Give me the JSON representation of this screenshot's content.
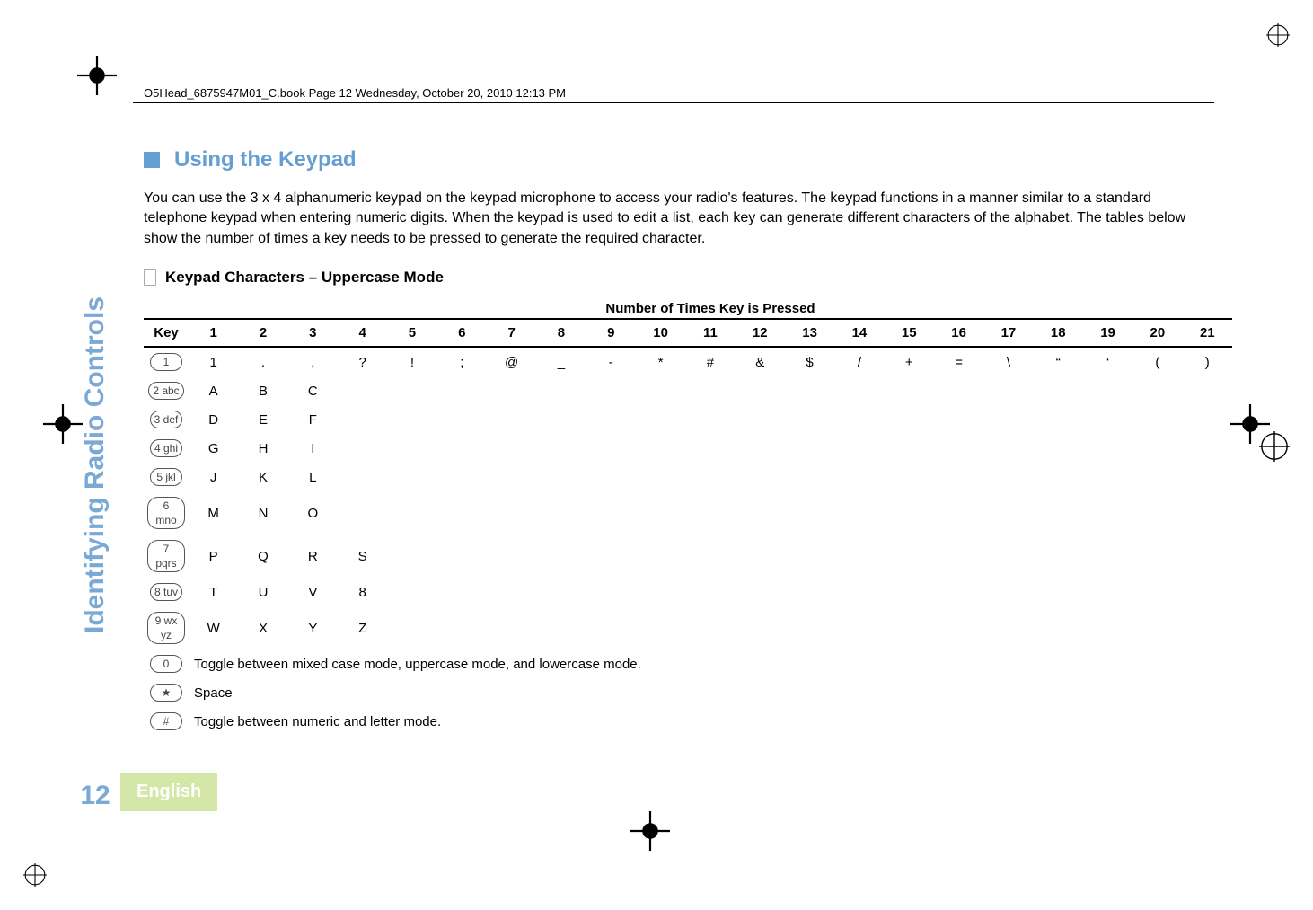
{
  "page_header": "O5Head_6875947M01_C.book  Page 12  Wednesday, October 20, 2010  12:13 PM",
  "sidebar": {
    "vertical_label": "Identifying Radio Controls",
    "page_number": "12",
    "language": "English"
  },
  "section": {
    "title": "Using the Keypad",
    "paragraph": "You can use the 3 x 4 alphanumeric keypad on the keypad microphone to access your radio's features. The keypad functions in a manner similar to a standard telephone keypad when entering numeric digits. When the keypad is used to edit a list, each key can generate different characters of the alphabet. The tables below show the number of times a key needs to be pressed to generate the required character.",
    "subheading": "Keypad Characters – Uppercase Mode"
  },
  "table": {
    "group_header": "Number of Times Key is Pressed",
    "key_label": "Key",
    "columns": {
      "c1": "1",
      "c2": "2",
      "c3": "3",
      "c4": "4",
      "c5": "5",
      "c6": "6",
      "c7": "7",
      "c8": "8",
      "c9": "9",
      "c10": "10",
      "c11": "11",
      "c12": "12",
      "c13": "13",
      "c14": "14",
      "c15": "15",
      "c16": "16",
      "c17": "17",
      "c18": "18",
      "c19": "19",
      "c20": "20",
      "c21": "21"
    },
    "rows": {
      "r1": {
        "key": "1",
        "c1": "1",
        "c2": ".",
        "c3": ",",
        "c4": "?",
        "c5": "!",
        "c6": ";",
        "c7": "@",
        "c8": "_",
        "c9": "-",
        "c10": "*",
        "c11": "#",
        "c12": "&",
        "c13": "$",
        "c14": "/",
        "c15": "+",
        "c16": "=",
        "c17": "\\",
        "c18": "“",
        "c19": "‘",
        "c20": "(",
        "c21": ")"
      },
      "r2": {
        "key": "2 abc",
        "c1": "A",
        "c2": "B",
        "c3": "C"
      },
      "r3": {
        "key": "3 def",
        "c1": "D",
        "c2": "E",
        "c3": "F"
      },
      "r4": {
        "key": "4 ghi",
        "c1": "G",
        "c2": "H",
        "c3": "I"
      },
      "r5": {
        "key": "5 jkl",
        "c1": "J",
        "c2": "K",
        "c3": "L"
      },
      "r6": {
        "key": "6 mno",
        "c1": "M",
        "c2": "N",
        "c3": "O"
      },
      "r7": {
        "key": "7 pqrs",
        "c1": "P",
        "c2": "Q",
        "c3": "R",
        "c4": "S"
      },
      "r8": {
        "key": "8 tuv",
        "c1": "T",
        "c2": "U",
        "c3": "V",
        "c4": "8"
      },
      "r9": {
        "key": "9 wx yz",
        "c1": "W",
        "c2": "X",
        "c3": "Y",
        "c4": "Z"
      },
      "r10": {
        "key": "0",
        "span": "Toggle between mixed case mode, uppercase mode, and lowercase mode."
      },
      "r11": {
        "key": "★",
        "span": "Space"
      },
      "r12": {
        "key": "#",
        "span": "Toggle between numeric and letter mode."
      }
    }
  },
  "icons": {
    "section_square": "section-square-icon",
    "document": "document-icon",
    "registration": "registration-mark-icon",
    "crosshair": "crosshair-icon"
  }
}
